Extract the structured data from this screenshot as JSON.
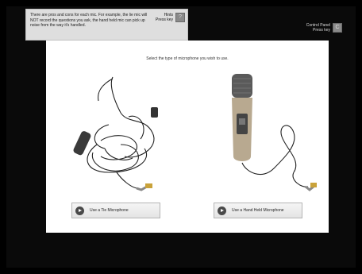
{
  "hint": {
    "text": "There are pros and cons for each mic. For example, the lie mic will NOT record the questions you ask, the hand held mic can pick up noise from the way it's handled.",
    "key_label_1": "Hints",
    "key_label_2": "Press key",
    "key_glyph": "?"
  },
  "control_panel": {
    "label_1": "Control Panel",
    "label_2": "Press key",
    "key_glyph": "C"
  },
  "content": {
    "instruction": "Select the type of microphone you wish to use.",
    "choices": [
      {
        "label": "Use a Tie Microphone",
        "icon": "play-icon"
      },
      {
        "label": "Use a Hand Held Microphone",
        "icon": "play-icon"
      }
    ]
  },
  "colors": {
    "background": "#000000",
    "panel": "#ffffff",
    "hint_bg": "#dedede"
  }
}
